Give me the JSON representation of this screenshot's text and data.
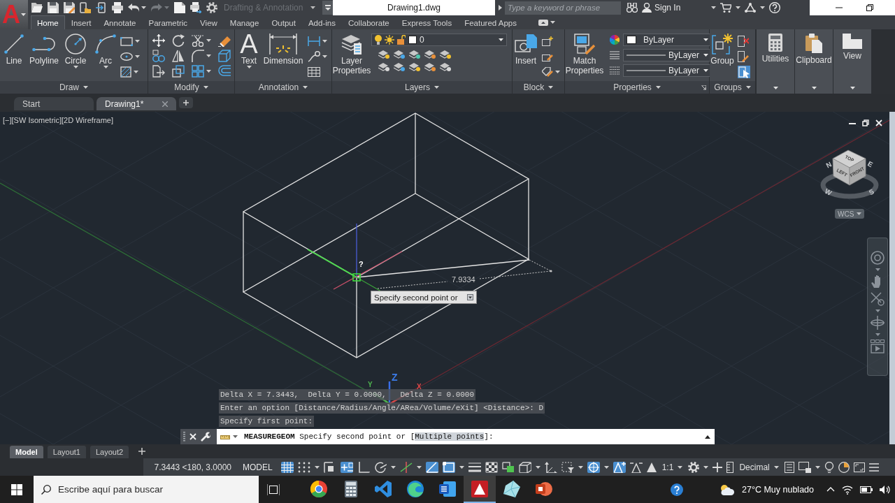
{
  "app_menu": {
    "logo": "A"
  },
  "title_bar": {
    "workspace": "Drafting & Annotation",
    "title": "Drawing1.dwg",
    "search": {
      "placeholder": "Type a keyword or phrase"
    },
    "sign_in": "Sign In"
  },
  "ribbon": {
    "tabs": [
      {
        "label": "Home",
        "selected": true
      },
      {
        "label": "Insert",
        "selected": false
      },
      {
        "label": "Annotate",
        "selected": false
      },
      {
        "label": "Parametric",
        "selected": false
      },
      {
        "label": "View",
        "selected": false
      },
      {
        "label": "Manage",
        "selected": false
      },
      {
        "label": "Output",
        "selected": false
      },
      {
        "label": "Add-ins",
        "selected": false
      },
      {
        "label": "Collaborate",
        "selected": false
      },
      {
        "label": "Express Tools",
        "selected": false
      },
      {
        "label": "Featured Apps",
        "selected": false
      }
    ],
    "panels": [
      {
        "kind": "draw",
        "title": "Draw",
        "tools": [
          "Line",
          "Polyline",
          "Circle",
          "Arc"
        ]
      },
      {
        "kind": "modify",
        "title": "Modify"
      },
      {
        "kind": "annotation",
        "title": "Annotation",
        "tools": [
          "Text",
          "Dimension"
        ],
        "text_tool_glyph": "A"
      },
      {
        "kind": "layers",
        "title": "Layers",
        "tools": [
          "Layer Properties"
        ],
        "current_layer": "0"
      },
      {
        "kind": "block",
        "title": "Block",
        "tools": [
          "Insert"
        ]
      },
      {
        "kind": "properties",
        "title": "Properties",
        "tools": [
          "Match Properties"
        ],
        "color_setting": "ByLayer",
        "linetype": "ByLayer",
        "lineweight": "ByLayer"
      },
      {
        "kind": "groups",
        "title": "Groups",
        "tools": [
          "Group"
        ],
        "selection_on": true
      }
    ],
    "collapsed_panels": [
      {
        "label": "Utilities"
      },
      {
        "label": "Clipboard"
      },
      {
        "label": "View"
      }
    ]
  },
  "file_tabs": [
    {
      "kind": "start",
      "label": "Start",
      "selected": false
    },
    {
      "kind": "drawing",
      "label": "Drawing1*",
      "selected": true
    }
  ],
  "viewport": {
    "controls": [
      "[−]",
      "[SW Isometric]",
      "[2D Wireframe]"
    ],
    "view_cube": {
      "faces": [
        "TOP",
        "LEFT",
        "FRONT"
      ],
      "compass": [
        "N",
        "E",
        "S",
        "W"
      ],
      "ucs_menu": "WCS"
    },
    "cursor_badge": "?",
    "dimension": "7.9334",
    "tooltip": "Specify second point or",
    "ucs_icon": [
      "X",
      "Y",
      "Z"
    ]
  },
  "command_history": [
    "Delta X = 7.3443,  Delta Y = 0.0000,   Delta Z = 0.0000",
    "Enter an option [Distance/Radius/Angle/ARea/Volume/eXit] <Distance>: D",
    "Specify first point:"
  ],
  "command_line": {
    "command": "MEASUREGEOM",
    "prompt": "Specify second point or [",
    "option": "Multiple points",
    "suffix": "]:"
  },
  "layout_tabs": [
    {
      "label": "Model",
      "selected": true
    },
    {
      "label": "Layout1",
      "selected": false
    },
    {
      "label": "Layout2",
      "selected": false
    }
  ],
  "status_bar": {
    "coordinates": "7.3443 <180, 3.0000",
    "space": "MODEL",
    "toggles": [
      {
        "on": true
      },
      {
        "on": false
      },
      {
        "on": false
      },
      {
        "on": true
      },
      {
        "on": false
      },
      {
        "on": false
      },
      {
        "on": false
      },
      {
        "on": true
      },
      {
        "on": true
      },
      {
        "on": false
      },
      {
        "on": false
      },
      {
        "on": false
      },
      {
        "on": false
      },
      {
        "on": false
      },
      {
        "on": false
      },
      {
        "on": true
      },
      {
        "on": true
      },
      {
        "on": false
      }
    ],
    "annotation_scale": "1:1",
    "units": "Decimal"
  },
  "taskbar": {
    "search": {
      "placeholder": "Escribe aquí para buscar"
    },
    "apps": [
      {
        "active": false
      },
      {
        "active": false
      },
      {
        "active": false
      },
      {
        "active": false
      },
      {
        "active": false
      },
      {
        "active": true
      },
      {
        "active": false
      },
      {
        "active": false
      }
    ],
    "weather": "27°C Muy nublado"
  }
}
